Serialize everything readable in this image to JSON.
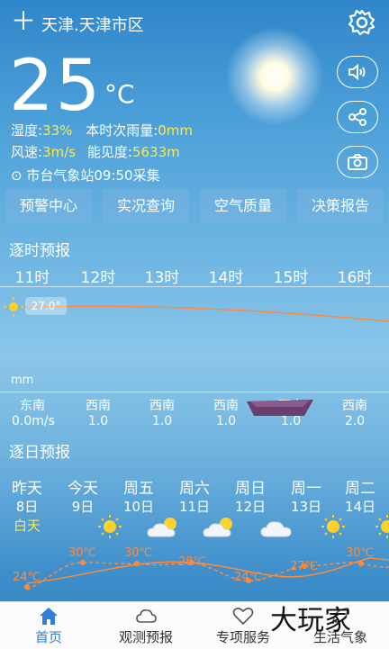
{
  "header": {
    "location": "天津.天津市区"
  },
  "current": {
    "temperature": "25",
    "unit": "°C",
    "humidity_label": "湿度:",
    "humidity": "33%",
    "rain_label": "本时次雨量:",
    "rain": "0mm",
    "wind_label": "风速:",
    "wind": "3m/s",
    "visibility_label": "能见度:",
    "visibility": "5633m",
    "station": "市台气象站09:50采集"
  },
  "quick_buttons": [
    "预警中心",
    "实况查询",
    "空气质量",
    "决策报告"
  ],
  "hourly": {
    "title": "逐时预报",
    "hours": [
      "11时",
      "12时",
      "13时",
      "14时",
      "15时",
      "16时"
    ],
    "temp_label": "27.0°",
    "rain_unit": "mm",
    "wind_dirs": [
      "东南",
      "西南",
      "西南",
      "西南",
      "西南",
      "西南"
    ],
    "wind_vals": [
      "0.0m/s",
      "1.0",
      "1.0",
      "1.0",
      "1.0",
      "2.0"
    ]
  },
  "daily": {
    "title": "逐日预报",
    "days": [
      {
        "name": "昨天",
        "date": "8日",
        "weather": "白天",
        "icon": "text"
      },
      {
        "name": "今天",
        "date": "9日",
        "icon": "sun-icon"
      },
      {
        "name": "周五",
        "date": "10日",
        "icon": "partly-cloudy-icon"
      },
      {
        "name": "周六",
        "date": "11日",
        "icon": "partly-cloudy-icon"
      },
      {
        "name": "周日",
        "date": "12日",
        "icon": "cloud-icon"
      },
      {
        "name": "周一",
        "date": "13日",
        "icon": "sun-icon"
      },
      {
        "name": "周二",
        "date": "14日",
        "icon": "sun-icon"
      }
    ],
    "high_temps": [
      "30℃",
      "30℃",
      "30℃"
    ],
    "low_temps": [
      "24℃",
      "28℃",
      "24℃",
      "27℃"
    ]
  },
  "nav": [
    {
      "label": "首页",
      "icon": "home-icon"
    },
    {
      "label": "观测预报",
      "icon": "cloud-icon"
    },
    {
      "label": "专项服务",
      "icon": "heart-icon"
    },
    {
      "label": "生活气象",
      "icon": "leaf-icon"
    }
  ],
  "watermark": "大玩家",
  "colors": {
    "accent": "#ffe94a",
    "temp_line": "#ff8a3a",
    "nav_active": "#2f7fd6"
  }
}
